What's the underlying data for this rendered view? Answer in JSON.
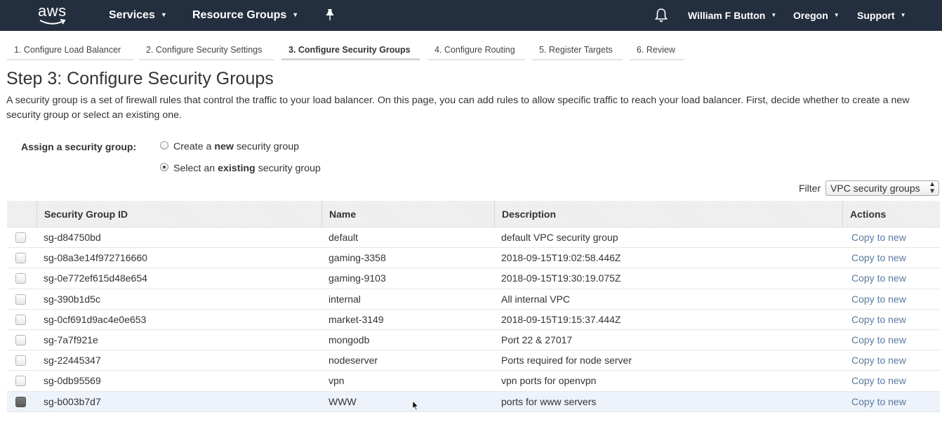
{
  "topnav": {
    "logo": "aws",
    "services": "Services",
    "resource_groups": "Resource Groups",
    "user": "William F Button",
    "region": "Oregon",
    "support": "Support"
  },
  "tabs": [
    {
      "label": "1. Configure Load Balancer"
    },
    {
      "label": "2. Configure Security Settings"
    },
    {
      "label": "3. Configure Security Groups"
    },
    {
      "label": "4. Configure Routing"
    },
    {
      "label": "5. Register Targets"
    },
    {
      "label": "6. Review"
    }
  ],
  "page": {
    "title": "Step 3: Configure Security Groups",
    "description": "A security group is a set of firewall rules that control the traffic to your load balancer. On this page, you can add rules to allow specific traffic to reach your load balancer. First, decide whether to create a new security group or select an existing one."
  },
  "assign": {
    "label": "Assign a security group:",
    "option_new": {
      "pre": "Create a ",
      "bold": "new",
      "post": " security group",
      "checked": false
    },
    "option_existing": {
      "pre": "Select an ",
      "bold": "existing",
      "post": " security group",
      "checked": true
    }
  },
  "filter": {
    "label": "Filter",
    "value": "VPC security groups"
  },
  "table": {
    "headers": {
      "id": "Security Group ID",
      "name": "Name",
      "description": "Description",
      "actions": "Actions"
    },
    "rows": [
      {
        "id": "sg-d84750bd",
        "name": "default",
        "description": "default VPC security group",
        "action": "Copy to new",
        "checked": false
      },
      {
        "id": "sg-08a3e14f972716660",
        "name": "gaming-3358",
        "description": "2018-09-15T19:02:58.446Z",
        "action": "Copy to new",
        "checked": false
      },
      {
        "id": "sg-0e772ef615d48e654",
        "name": "gaming-9103",
        "description": "2018-09-15T19:30:19.075Z",
        "action": "Copy to new",
        "checked": false
      },
      {
        "id": "sg-390b1d5c",
        "name": "internal",
        "description": "All internal VPC",
        "action": "Copy to new",
        "checked": false
      },
      {
        "id": "sg-0cf691d9ac4e0e653",
        "name": "market-3149",
        "description": "2018-09-15T19:15:37.444Z",
        "action": "Copy to new",
        "checked": false
      },
      {
        "id": "sg-7a7f921e",
        "name": "mongodb",
        "description": "Port 22 & 27017",
        "action": "Copy to new",
        "checked": false
      },
      {
        "id": "sg-22445347",
        "name": "nodeserver",
        "description": "Ports required for node server",
        "action": "Copy to new",
        "checked": false
      },
      {
        "id": "sg-0db95569",
        "name": "vpn",
        "description": "vpn ports for openvpn",
        "action": "Copy to new",
        "checked": false
      },
      {
        "id": "sg-b003b7d7",
        "name": "WWW",
        "description": "ports for www servers",
        "action": "Copy to new",
        "checked": true
      }
    ]
  },
  "colors": {
    "nav_bg": "#232f3e",
    "link": "#5b7a9f",
    "selected_row": "#eef2fa"
  }
}
